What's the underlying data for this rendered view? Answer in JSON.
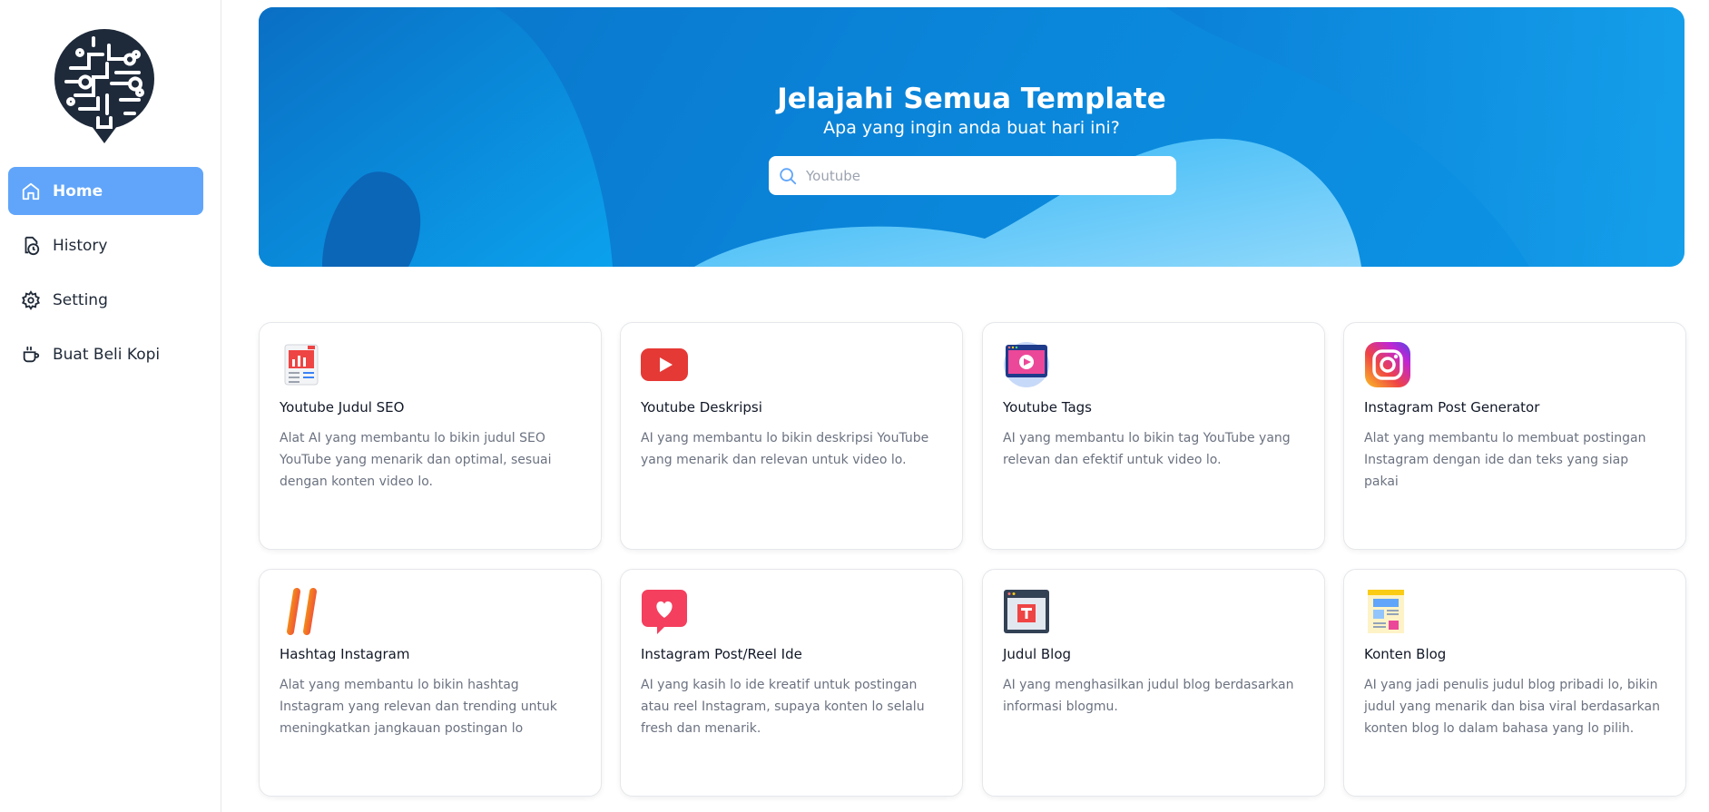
{
  "sidebar": {
    "items": [
      {
        "label": "Home",
        "icon": "home-icon",
        "active": true
      },
      {
        "label": "History",
        "icon": "history-icon",
        "active": false
      },
      {
        "label": "Setting",
        "icon": "gear-icon",
        "active": false
      },
      {
        "label": "Buat Beli Kopi",
        "icon": "coffee-cup-icon",
        "active": false
      }
    ]
  },
  "hero": {
    "title": "Jelajahi Semua Template",
    "subtitle": "Apa yang ingin anda buat hari ini?",
    "search_placeholder": "Youtube"
  },
  "cards": [
    {
      "title": "Youtube Judul SEO",
      "desc": "Alat AI yang membantu lo bikin judul SEO YouTube yang menarik dan optimal, sesuai dengan konten video lo.",
      "icon": "seo-report-icon"
    },
    {
      "title": "Youtube Deskripsi",
      "desc": "AI yang membantu lo bikin deskripsi YouTube yang menarik dan relevan untuk video lo.",
      "icon": "youtube-play-icon"
    },
    {
      "title": "Youtube Tags",
      "desc": "AI yang membantu lo bikin tag YouTube yang relevan dan efektif untuk video lo.",
      "icon": "video-browser-icon"
    },
    {
      "title": "Instagram Post Generator",
      "desc": "Alat yang membantu lo membuat postingan Instagram dengan ide dan teks yang siap pakai",
      "icon": "instagram-icon"
    },
    {
      "title": "Hashtag Instagram",
      "desc": "Alat yang membantu lo bikin hashtag Instagram yang relevan dan trending untuk meningkatkan jangkauan postingan lo",
      "icon": "hashtag-icon"
    },
    {
      "title": "Instagram Post/Reel Ide",
      "desc": "AI yang kasih lo ide kreatif untuk postingan atau reel Instagram, supaya konten lo selalu fresh dan menarik.",
      "icon": "heart-chat-icon"
    },
    {
      "title": "Judul Blog",
      "desc": "AI yang menghasilkan judul blog berdasarkan informasi blogmu.",
      "icon": "blog-title-window-icon"
    },
    {
      "title": "Konten Blog",
      "desc": "AI yang jadi penulis judul blog pribadi lo, bikin judul yang menarik dan bisa viral berdasarkan konten blog lo dalam bahasa yang lo pilih.",
      "icon": "blog-document-icon"
    }
  ],
  "colors": {
    "accent": "#60a5fa",
    "hero_blue": "#0a84d8"
  }
}
